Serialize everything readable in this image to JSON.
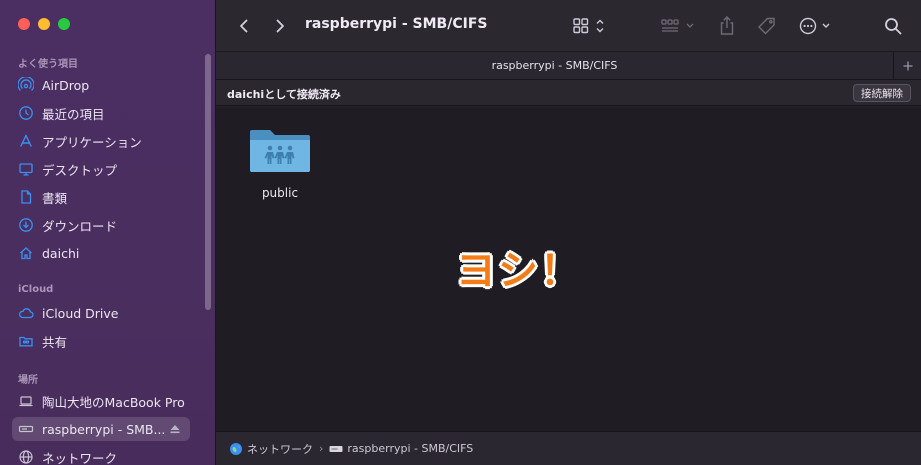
{
  "sidebar": {
    "favorites_title": "よく使う項目",
    "favorites": [
      {
        "label": "AirDrop",
        "icon": "airdrop-icon"
      },
      {
        "label": "最近の項目",
        "icon": "clock-icon"
      },
      {
        "label": "アプリケーション",
        "icon": "applications-icon"
      },
      {
        "label": "デスクトップ",
        "icon": "desktop-icon"
      },
      {
        "label": "書類",
        "icon": "document-icon"
      },
      {
        "label": "ダウンロード",
        "icon": "download-icon"
      },
      {
        "label": "daichi",
        "icon": "home-icon"
      }
    ],
    "icloud_title": "iCloud",
    "icloud": [
      {
        "label": "iCloud Drive",
        "icon": "cloud-icon"
      },
      {
        "label": "共有",
        "icon": "shared-folder-icon"
      }
    ],
    "locations_title": "場所",
    "locations": [
      {
        "label": "陶山大地のMacBook Pro",
        "icon": "laptop-icon"
      },
      {
        "label": "raspberrypi - SMB...",
        "icon": "server-icon"
      },
      {
        "label": "ネットワーク",
        "icon": "network-icon"
      }
    ]
  },
  "toolbar": {
    "title": "raspberrypi - SMB/CIFS"
  },
  "tab": {
    "label": "raspberrypi - SMB/CIFS"
  },
  "connection": {
    "status": "daichiとして接続済み",
    "disconnect_label": "接続解除"
  },
  "content": {
    "folder_name": "public",
    "overlay_text": "ヨシ！"
  },
  "pathbar": {
    "network": "ネットワーク",
    "server": "raspberrypi - SMB/CIFS"
  },
  "colors": {
    "accent": "#3b8ff0",
    "sidebar": "#4b2f63",
    "overlay": "#f57c14"
  }
}
